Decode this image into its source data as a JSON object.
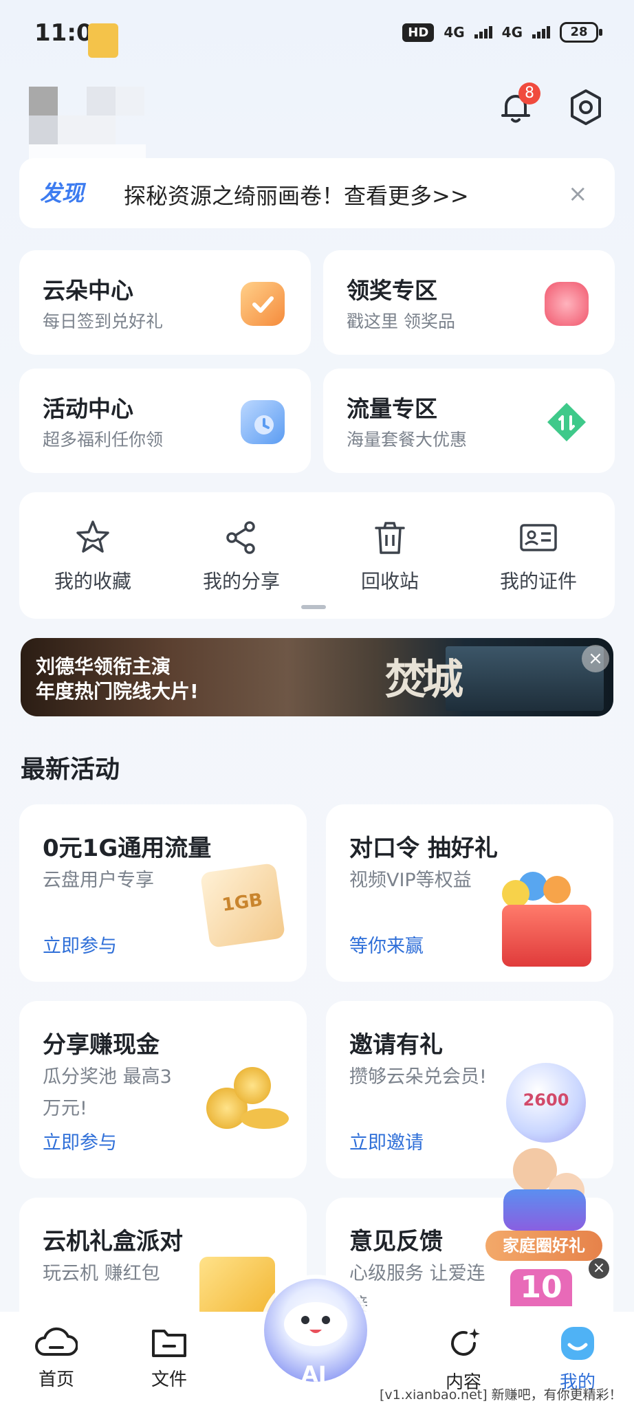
{
  "status_bar": {
    "time": "11:08",
    "hd": "HD",
    "net1": "4G",
    "net2": "4G",
    "battery": "28"
  },
  "header": {
    "notification_count": "8"
  },
  "notice": {
    "logo": "发现",
    "text": "探秘资源之绮丽画卷！查看更多>>",
    "close": "×"
  },
  "services": [
    {
      "title": "云朵中心",
      "subtitle": "每日签到兑好礼",
      "icon": "calendar-check-icon",
      "color": "#f59a45"
    },
    {
      "title": "领奖专区",
      "subtitle": "戳这里 领奖品",
      "icon": "gift-icon",
      "color": "#f26b7a"
    },
    {
      "title": "活动中心",
      "subtitle": "超多福利任你领",
      "icon": "clock-folder-icon",
      "color": "#5b9cf2"
    },
    {
      "title": "流量专区",
      "subtitle": "海量套餐大优惠",
      "icon": "data-diamond-icon",
      "color": "#3fc98a"
    }
  ],
  "quick_actions": [
    {
      "label": "我的收藏",
      "icon": "star-icon"
    },
    {
      "label": "我的分享",
      "icon": "share-icon"
    },
    {
      "label": "回收站",
      "icon": "trash-icon"
    },
    {
      "label": "我的证件",
      "icon": "id-card-icon"
    }
  ],
  "banner": {
    "line1": "刘德华领衔主演",
    "line2": "年度热门院线大片!",
    "art": "焚城",
    "close": "×"
  },
  "section_title": "最新活动",
  "activities": [
    {
      "title": "0元1G通用流量",
      "subtitle": "云盘用户专享",
      "link": "立即参与",
      "art": "1GB"
    },
    {
      "title": "对口令 抽好礼",
      "subtitle": "视频VIP等权益",
      "link": "等你来赢",
      "art": "gift-box"
    },
    {
      "title": "分享赚现金",
      "subtitle": "瓜分奖池 最高3万元!",
      "link": "立即参与",
      "art": "coins"
    },
    {
      "title": "邀请有礼",
      "subtitle": "攒够云朵兑会员!",
      "link": "立即邀请",
      "art": "2600"
    },
    {
      "title": "云机礼盒派对",
      "subtitle": "玩云机 赚红包",
      "link": "",
      "art": "gift"
    },
    {
      "title": "意见反馈",
      "subtitle": "心级服务 让爱连接",
      "link": "",
      "art": "10"
    }
  ],
  "family_promo": {
    "label": "家庭圈好礼",
    "close": "×"
  },
  "bottom_nav": [
    {
      "label": "首页",
      "icon": "cloud-home-icon"
    },
    {
      "label": "文件",
      "icon": "folder-icon"
    },
    {
      "label": "AI",
      "icon": "ai-cloud-mascot-icon"
    },
    {
      "label": "内容",
      "icon": "refresh-sparkle-icon"
    },
    {
      "label": "我的",
      "icon": "smile-face-icon"
    }
  ],
  "watermark": "[v1.xianbao.net] 新赚吧，有你更精彩！"
}
